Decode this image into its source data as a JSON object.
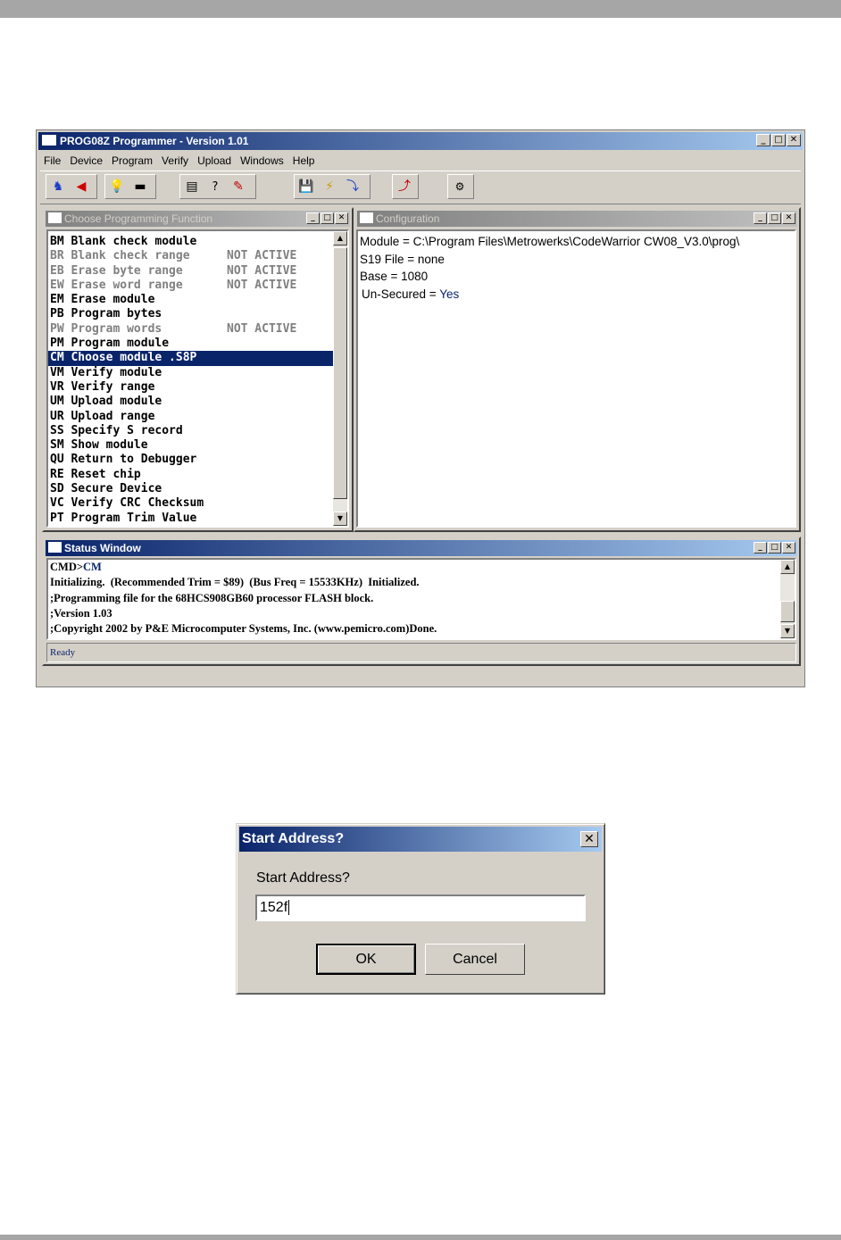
{
  "app": {
    "title": "PROG08Z Programmer - Version 1.01",
    "menu": [
      "File",
      "Device",
      "Program",
      "Verify",
      "Upload",
      "Windows",
      "Help"
    ]
  },
  "function_window": {
    "title": "Choose Programming Function",
    "items": [
      {
        "code": "BM",
        "label": "Blank check module",
        "status": "",
        "enabled": true
      },
      {
        "code": "BR",
        "label": "Blank check range",
        "status": "NOT ACTIVE",
        "enabled": false
      },
      {
        "code": "EB",
        "label": "Erase byte range",
        "status": "NOT ACTIVE",
        "enabled": false
      },
      {
        "code": "EW",
        "label": "Erase word range",
        "status": "NOT ACTIVE",
        "enabled": false
      },
      {
        "code": "EM",
        "label": "Erase module",
        "status": "",
        "enabled": true
      },
      {
        "code": "PB",
        "label": "Program bytes",
        "status": "",
        "enabled": true
      },
      {
        "code": "PW",
        "label": "Program words",
        "status": "NOT ACTIVE",
        "enabled": false
      },
      {
        "code": "PM",
        "label": "Program module",
        "status": "",
        "enabled": true
      },
      {
        "code": "CM",
        "label": "Choose module .S8P",
        "status": "",
        "enabled": true,
        "selected": true
      },
      {
        "code": "VM",
        "label": "Verify module",
        "status": "",
        "enabled": true
      },
      {
        "code": "VR",
        "label": "Verify range",
        "status": "",
        "enabled": true
      },
      {
        "code": "UM",
        "label": "Upload module",
        "status": "",
        "enabled": true
      },
      {
        "code": "UR",
        "label": "Upload range",
        "status": "",
        "enabled": true
      },
      {
        "code": "SS",
        "label": "Specify S record",
        "status": "",
        "enabled": true
      },
      {
        "code": "SM",
        "label": "Show module",
        "status": "",
        "enabled": true
      },
      {
        "code": "QU",
        "label": "Return to Debugger",
        "status": "",
        "enabled": true
      },
      {
        "code": "RE",
        "label": "Reset chip",
        "status": "",
        "enabled": true
      },
      {
        "code": "SD",
        "label": "Secure Device",
        "status": "",
        "enabled": true
      },
      {
        "code": "VC",
        "label": "Verify CRC Checksum",
        "status": "",
        "enabled": true
      },
      {
        "code": "PT",
        "label": "Program Trim Value",
        "status": "",
        "enabled": true
      }
    ]
  },
  "config_window": {
    "title": "Configuration",
    "module": "Module = C:\\Program Files\\Metrowerks\\CodeWarrior CW08_V3.0\\prog\\",
    "s19": "S19 File = none",
    "base": "Base = 1080",
    "unsecured_label": "Un-Secured = ",
    "unsecured_value": "Yes"
  },
  "status_window": {
    "title": "Status Window",
    "prompt": "CMD>",
    "command": "CM",
    "lines": [
      "Initializing.  (Recommended Trim = $89)  (Bus Freq = 15533KHz)  Initialized.",
      ";Programming file for the 68HCS908GB60 processor FLASH block.",
      ";Version 1.03",
      ";Copyright 2002 by P&E Microcomputer Systems, Inc. (www.pemicro.com)Done."
    ],
    "statusbar": "Ready"
  },
  "dialog": {
    "title": "Start Address?",
    "prompt": "Start Address?",
    "value": "152f",
    "ok": "OK",
    "cancel": "Cancel"
  },
  "colors": {
    "title_active": "#0a246a",
    "title_gradient_end": "#a6caf0",
    "face": "#d4d0c8",
    "selection": "#0a246a"
  }
}
